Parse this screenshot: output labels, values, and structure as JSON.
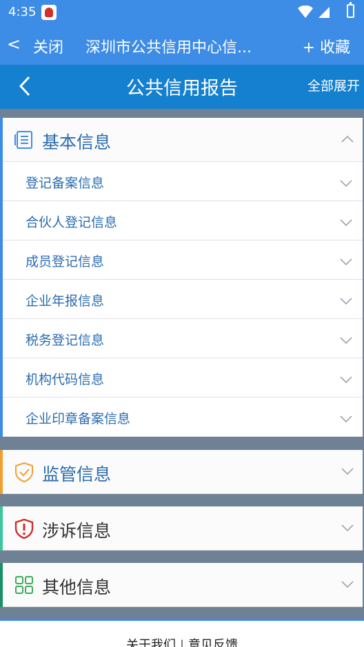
{
  "status_bar": {
    "time": "4:35"
  },
  "browser_bar": {
    "back_glyph": "<",
    "close_label": "关闭",
    "title": "深圳市公共信用中心信...",
    "favorite_label": "+ 收藏"
  },
  "page_header": {
    "title": "公共信用报告",
    "expand_all_label": "全部展开"
  },
  "sections": {
    "basic": {
      "label": "基本信息",
      "icon": "document-list-icon",
      "accent": "#3d8ce6",
      "expanded": true,
      "items": [
        {
          "label": "登记备案信息"
        },
        {
          "label": "合伙人登记信息"
        },
        {
          "label": "成员登记信息"
        },
        {
          "label": "企业年报信息"
        },
        {
          "label": "税务登记信息"
        },
        {
          "label": "机构代码信息"
        },
        {
          "label": "企业印章备案信息"
        }
      ]
    },
    "supervision": {
      "label": "监管信息",
      "icon": "shield-check-icon",
      "accent": "#f0a030"
    },
    "complaint": {
      "label": "涉诉信息",
      "icon": "shield-alert-icon",
      "accent": "#3cc6a0",
      "icon_color": "#d42b2b"
    },
    "other": {
      "label": "其他信息",
      "icon": "grid-icon",
      "accent": "#1b8f6a",
      "icon_color": "#3cab5a"
    }
  },
  "footer": {
    "about_label": "关于我们",
    "separator": "|",
    "feedback_label": "意见反馈"
  },
  "colors": {
    "primary": "#3d8ce6",
    "header": "#1580cf",
    "link_text": "#2b6cb0",
    "background_gap": "#6f8194"
  }
}
